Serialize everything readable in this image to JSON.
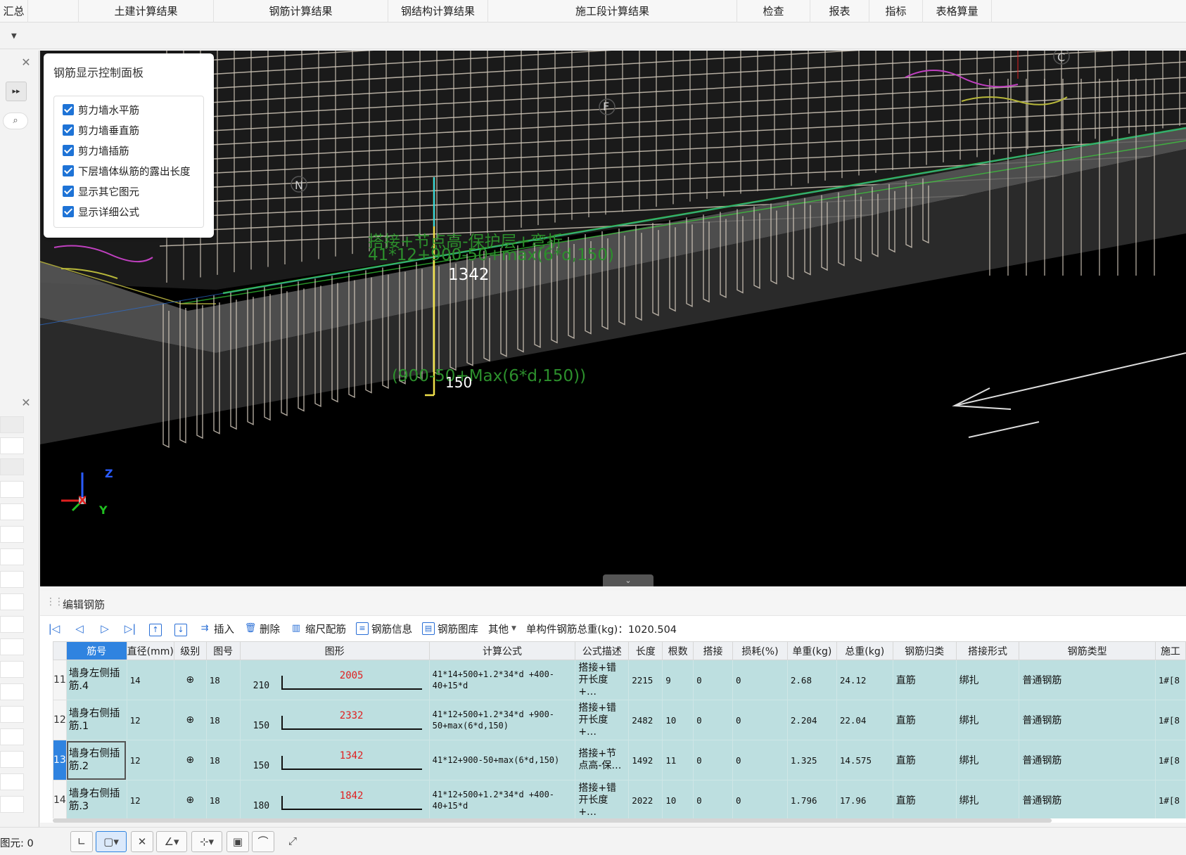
{
  "menu": {
    "items": [
      "汇总",
      "土建计算结果",
      "钢筋计算结果",
      "钢结构计算结果",
      "施工段计算结果",
      "检查",
      "报表",
      "指标",
      "表格算量"
    ]
  },
  "viewport": {
    "axis_labels": {
      "c": "C",
      "f": "F",
      "n": "N"
    },
    "dims": {
      "d1342": "1342",
      "d150": "150"
    },
    "formula_green_1": "搭接+节点高-保护层+弯折",
    "formula_green_2": "41*12+900-50+max(6*d,150)",
    "formula_green_3": "(900-50+Max(6*d,150))",
    "triad": {
      "x": "X",
      "y": "Y",
      "z": "Z"
    }
  },
  "control_panel": {
    "title": "钢筋显示控制面板",
    "options": [
      {
        "label": "剪力墙水平筋",
        "checked": true
      },
      {
        "label": "剪力墙垂直筋",
        "checked": true
      },
      {
        "label": "剪力墙插筋",
        "checked": true
      },
      {
        "label": "下层墙体纵筋的露出长度",
        "checked": true
      },
      {
        "label": "显示其它图元",
        "checked": true
      },
      {
        "label": "显示详细公式",
        "checked": true
      }
    ]
  },
  "edit_panel": {
    "title": "编辑钢筋",
    "toolbar": {
      "insert": "插入",
      "delete": "删除",
      "scale": "缩尺配筋",
      "info": "钢筋信息",
      "library": "钢筋图库",
      "other": "其他",
      "total_weight_label": "单构件钢筋总重(kg)：1020.504"
    },
    "columns": [
      "筋号",
      "直径(mm)",
      "级别",
      "图号",
      "图形",
      "计算公式",
      "公式描述",
      "长度",
      "根数",
      "搭接",
      "损耗(%)",
      "单重(kg)",
      "总重(kg)",
      "钢筋归类",
      "搭接形式",
      "钢筋类型",
      "施工"
    ],
    "rows": [
      {
        "no": "11",
        "name": "墙身左侧插筋.4",
        "dia": "14",
        "grade": "⊕",
        "fig": "18",
        "lead": "210",
        "len_fig": "2005",
        "formula": "41*14+500+1.2*34*d +400-40+15*d",
        "desc": "搭接+错开长度+…",
        "length": "2215",
        "count": "9",
        "lap": "0",
        "loss": "0",
        "unit_w": "2.68",
        "total_w": "24.12",
        "category": "直筋",
        "lap_form": "绑扎",
        "type": "普通钢筋",
        "stage": "1#[8",
        "selected": false
      },
      {
        "no": "12",
        "name": "墙身右侧插筋.1",
        "dia": "12",
        "grade": "⊕",
        "fig": "18",
        "lead": "150",
        "len_fig": "2332",
        "formula": "41*12+500+1.2*34*d +900-50+max(6*d,150)",
        "desc": "搭接+错开长度+…",
        "length": "2482",
        "count": "10",
        "lap": "0",
        "loss": "0",
        "unit_w": "2.204",
        "total_w": "22.04",
        "category": "直筋",
        "lap_form": "绑扎",
        "type": "普通钢筋",
        "stage": "1#[8",
        "selected": false
      },
      {
        "no": "13",
        "name": "墙身右侧插筋.2",
        "dia": "12",
        "grade": "⊕",
        "fig": "18",
        "lead": "150",
        "len_fig": "1342",
        "formula": "41*12+900-50+max(6*d,150)",
        "desc": "搭接+节点高-保…",
        "length": "1492",
        "count": "11",
        "lap": "0",
        "loss": "0",
        "unit_w": "1.325",
        "total_w": "14.575",
        "category": "直筋",
        "lap_form": "绑扎",
        "type": "普通钢筋",
        "stage": "1#[8",
        "selected": true
      },
      {
        "no": "14",
        "name": "墙身右侧插筋.3",
        "dia": "12",
        "grade": "⊕",
        "fig": "18",
        "lead": "180",
        "len_fig": "1842",
        "formula": "41*12+500+1.2*34*d +400-40+15*d",
        "desc": "搭接+错开长度+…",
        "length": "2022",
        "count": "10",
        "lap": "0",
        "loss": "0",
        "unit_w": "1.796",
        "total_w": "17.96",
        "category": "直筋",
        "lap_form": "绑扎",
        "type": "普通钢筋",
        "stage": "1#[8",
        "selected": false
      }
    ]
  },
  "status": {
    "selected": "图元: 0"
  },
  "colors": {
    "accent": "#2f83e0",
    "row_bg": "#bddfe0",
    "shape_length": "#e02020",
    "viewport_bg": "#000000",
    "rebar": "#cfc6b8",
    "green_line": "#3ad23a"
  }
}
